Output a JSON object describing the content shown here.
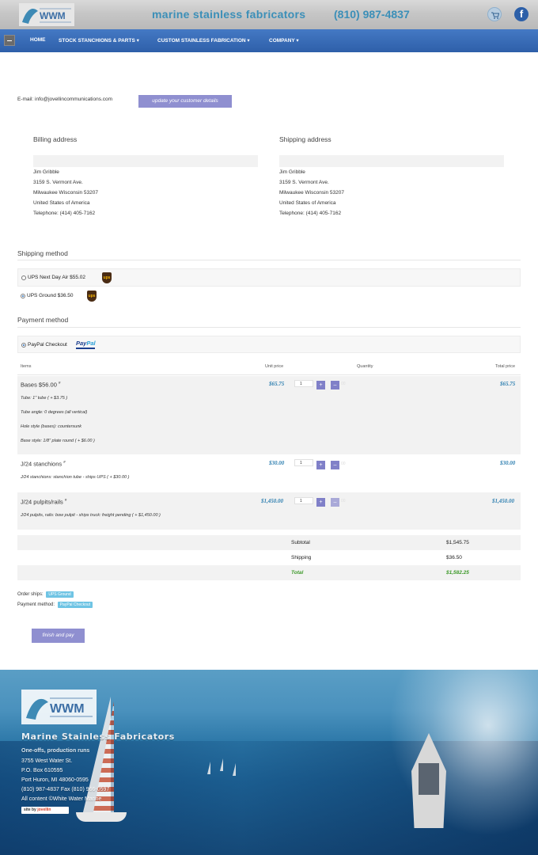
{
  "header": {
    "brand": "marine stainless fabricators",
    "phone": "(810) 987-4837",
    "facebook_glyph": "f"
  },
  "nav": {
    "items": [
      "HOME",
      "STOCK STANCHIONS & PARTS ▾",
      "CUSTOM STAINLESS FABRICATION ▾",
      "COMPANY ▾"
    ]
  },
  "account": {
    "email_line": "E-mail: info@jovellincommunications.com",
    "update_label": "update your customer details"
  },
  "billing": {
    "title": "Billing address",
    "lines": [
      "Jim Gribble",
      "3159 S. Vermont Ave.",
      "Milwaukee Wisconsin 53207",
      "United States of America",
      "Telephone: (414) 405-7162"
    ]
  },
  "shipping": {
    "title": "Shipping address",
    "lines": [
      "Jim Gribble",
      "3159 S. Vermont Ave.",
      "Milwaukee Wisconsin 53207",
      "United States of America",
      "Telephone: (414) 405-7162"
    ]
  },
  "shipping_method": {
    "title": "Shipping method",
    "options": [
      {
        "label": "UPS Next Day Air $55.02",
        "selected": false
      },
      {
        "label": "UPS Ground $36.50",
        "selected": true
      }
    ],
    "ups_text": "ups"
  },
  "payment_method": {
    "title": "Payment method",
    "option_label": "PayPal Checkout",
    "paypal_a": "Pay",
    "paypal_b": "Pal"
  },
  "items_table": {
    "headers": {
      "item": "Items",
      "unit_price": "Unit price",
      "quantity": "Quantity",
      "total_price": "Total price"
    },
    "rows": [
      {
        "name": "Bases $56.00",
        "sup": "#",
        "unit_price": "$65.75",
        "qty": "1",
        "total": "$65.75",
        "details": [
          "Tube: 1\" tube ( + $3.75 )",
          "Tube angle: 0 degrees (all vertical)",
          "Hole style (bases): countersunk",
          "Base style: 1/8\" plate round ( + $6.00 )"
        ]
      },
      {
        "name": "J/24 stanchions",
        "sup": "#",
        "unit_price": "$30.00",
        "qty": "1",
        "total": "$30.00",
        "details": [
          "J/24 stanchions: stanchion tube - ships UPS ( + $30.00 )"
        ]
      },
      {
        "name": "J/24 pulpits/rails",
        "sup": "#",
        "unit_price": "$1,450.00",
        "qty": "1",
        "total": "$1,450.00",
        "details": [
          "J/24 pulpits, rails: bow pulpit - ships truck: freight pending ( + $1,450.00 )"
        ]
      }
    ],
    "qty_plus": "+",
    "qty_minus": "–",
    "qty_hint": "00"
  },
  "totals": {
    "subtotal_label": "Subtotal",
    "subtotal": "$1,545.75",
    "shipping_label": "Shipping",
    "shipping": "$36.50",
    "total_label": "Total",
    "total": "$1,582.25"
  },
  "summary": {
    "ships_label": "Order ships:",
    "ships_value": "UPS Ground",
    "payment_label": "Payment method:",
    "payment_value": "PayPal Checkout"
  },
  "finish_label": "finish and pay",
  "footer": {
    "title": "Marine Stainless Fabricators",
    "tagline": "One-offs, production runs",
    "lines": [
      "3755 West Water St.",
      "P.O. Box 610595",
      "Port Huron, MI 48060-0595",
      "(810) 987-4837 Fax (810) 966-0597",
      "All content ©White Water Marine"
    ],
    "site_by": "site by",
    "site_brand": "jovellin"
  },
  "colors": {
    "nav_blue": "#3a6db8",
    "accent_blue": "#3b8fb8",
    "button_purple": "#8f8fd0",
    "total_green": "#3e9a2b"
  }
}
